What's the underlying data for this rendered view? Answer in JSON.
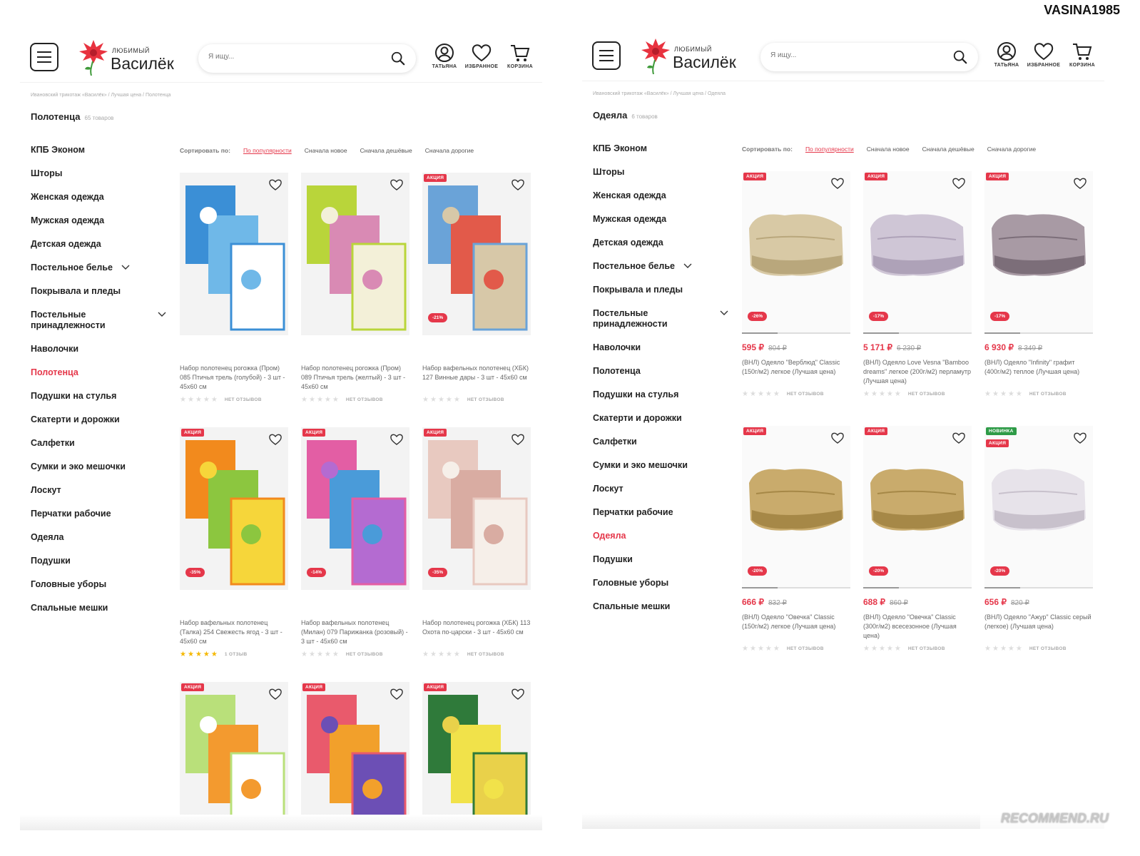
{
  "watermark": "VASINA1985",
  "rec_watermark": "RECOMMEND.RU",
  "header": {
    "logo_small": "ЛЮБИМЫЙ",
    "logo_big": "Василёк",
    "search_placeholder": "Я ищу...",
    "icons": [
      {
        "label": "ТАТЬЯНА",
        "icon": "user-icon"
      },
      {
        "label": "ИЗБРАННОЕ",
        "icon": "heart-icon"
      },
      {
        "label": "КОРЗИНА",
        "icon": "cart-icon"
      }
    ]
  },
  "sort": {
    "label": "Сортировать по:",
    "options": [
      "По популярности",
      "Сначала новое",
      "Сначала дешёвые",
      "Сначала дорогие"
    ]
  },
  "colors": {
    "accent": "#e5374a",
    "new_badge": "#2e9b47"
  },
  "left_page": {
    "breadcrumb": "Ивановский трикотаж «Василёк» / Лучшая цена / Полотенца",
    "title": "Полотенца",
    "count": "65 товаров",
    "categories": [
      "КПБ Эконом",
      "Шторы",
      "Женская одежда",
      "Мужская одежда",
      "Детская одежда",
      "Постельное белье",
      "Покрывала и пледы",
      "Постельные принадлежности",
      "Наволочки",
      "Полотенца",
      "Подушки на стулья",
      "Скатерти и дорожки",
      "Салфетки",
      "Сумки и эко мешочки",
      "Лоскут",
      "Перчатки рабочие",
      "Одеяла",
      "Подушки",
      "Головные уборы",
      "Спальные мешки"
    ],
    "products": [
      {
        "badge": "",
        "discount": "",
        "name": "Набор полотенец рогожка (Пром) 085 Птичья трель (голубой) - 3 шт - 45х60 см",
        "stars": 0,
        "reviews": "НЕТ ОТЗЫВОВ"
      },
      {
        "badge": "",
        "discount": "",
        "name": "Набор полотенец рогожка (Пром) 089 Птичья трель (желтый) - 3 шт - 45х60 см",
        "stars": 0,
        "reviews": "НЕТ ОТЗЫВОВ"
      },
      {
        "badge": "АКЦИЯ",
        "discount": "-21%",
        "name": "Набор вафельных полотенец (ХБК) 127 Винные дары - 3 шт - 45х60 см",
        "stars": 0,
        "reviews": "НЕТ ОТЗЫВОВ"
      },
      {
        "badge": "АКЦИЯ",
        "discount": "-35%",
        "name": "Набор вафельных полотенец (Талка) 254 Свежесть ягод - 3 шт - 45х60 см",
        "stars": 5,
        "reviews": "1 ОТЗЫВ"
      },
      {
        "badge": "АКЦИЯ",
        "discount": "-14%",
        "name": "Набор вафельных полотенец (Милан) 079 Парижанка (розовый) - 3 шт - 45х60 см",
        "stars": 0,
        "reviews": "НЕТ ОТЗЫВОВ"
      },
      {
        "badge": "АКЦИЯ",
        "discount": "-35%",
        "name": "Набор полотенец рогожка (ХБК) 113 Охота по-царски - 3 шт - 45х60 см",
        "stars": 0,
        "reviews": "НЕТ ОТЗЫВОВ"
      },
      {
        "badge": "АКЦИЯ",
        "discount": "",
        "name": "",
        "stars": 0,
        "reviews": ""
      },
      {
        "badge": "АКЦИЯ",
        "discount": "",
        "name": "",
        "stars": 0,
        "reviews": ""
      },
      {
        "badge": "АКЦИЯ",
        "discount": "",
        "name": "",
        "stars": 0,
        "reviews": ""
      }
    ]
  },
  "right_page": {
    "breadcrumb": "Ивановский трикотаж «Василёк» / Лучшая цена / Одеяла",
    "title": "Одеяла",
    "count": "6 товаров",
    "categories": [
      "КПБ Эконом",
      "Шторы",
      "Женская одежда",
      "Мужская одежда",
      "Детская одежда",
      "Постельное белье",
      "Покрывала и пледы",
      "Постельные принадлежности",
      "Наволочки",
      "Полотенца",
      "Подушки на стулья",
      "Скатерти и дорожки",
      "Салфетки",
      "Сумки и эко мешочки",
      "Лоскут",
      "Перчатки рабочие",
      "Одеяла",
      "Подушки",
      "Головные уборы",
      "Спальные мешки"
    ],
    "products": [
      {
        "badge": "АКЦИЯ",
        "badge2": "",
        "discount": "-26%",
        "price": "595 ₽",
        "old_price": "804 ₽",
        "name": "(ВНЛ) Одеяло \"Верблюд\" Classic (150г/м2) легкое (Лучшая цена)",
        "reviews": "НЕТ ОТЗЫВОВ"
      },
      {
        "badge": "АКЦИЯ",
        "badge2": "",
        "discount": "-17%",
        "price": "5 171 ₽",
        "old_price": "6 230 ₽",
        "name": "(ВНЛ) Одеяло Love Vesna \"Bamboo dreams\" легкое (200г/м2) перламутр (Лучшая цена)",
        "reviews": "НЕТ ОТЗЫВОВ"
      },
      {
        "badge": "АКЦИЯ",
        "badge2": "",
        "discount": "-17%",
        "price": "6 930 ₽",
        "old_price": "8 349 ₽",
        "name": "(ВНЛ) Одеяло \"Infinity\" графит (400г/м2) теплое (Лучшая цена)",
        "reviews": "НЕТ ОТЗЫВОВ"
      },
      {
        "badge": "АКЦИЯ",
        "badge2": "",
        "discount": "-20%",
        "price": "666 ₽",
        "old_price": "832 ₽",
        "name": "(ВНЛ) Одеяло \"Овечка\" Classic (150г/м2) легкое (Лучшая цена)",
        "reviews": "НЕТ ОТЗЫВОВ"
      },
      {
        "badge": "АКЦИЯ",
        "badge2": "",
        "discount": "-20%",
        "price": "688 ₽",
        "old_price": "860 ₽",
        "name": "(ВНЛ) Одеяло \"Овечка\" Classic (300г/м2) всесезонное (Лучшая цена)",
        "reviews": "НЕТ ОТЗЫВОВ"
      },
      {
        "badge": "НОВИНКА",
        "badge2": "АКЦИЯ",
        "discount": "-20%",
        "price": "656 ₽",
        "old_price": "820 ₽",
        "name": "(ВНЛ) Одеяло \"Ажур\" Classic серый (легкое) (Лучшая цена)",
        "reviews": "НЕТ ОТЗЫВОВ"
      }
    ]
  }
}
